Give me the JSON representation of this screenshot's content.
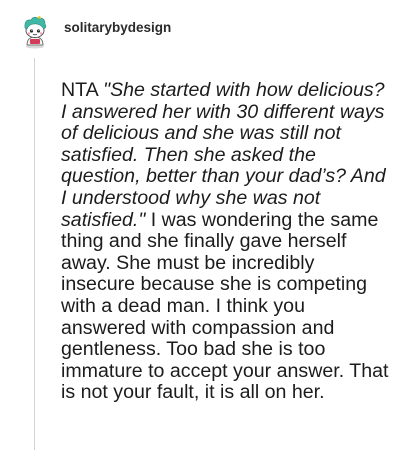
{
  "comment": {
    "username": "solitarybydesign",
    "avatar_icon": "snoo-avatar-icon",
    "body_prefix": "NTA ",
    "body_quote": "\"She started with how delicious? I answered her with 30 different ways of delicious and she was still not satisfied. Then she asked the question, better than your dad’s? And I understood why she was not satisfied.\"",
    "body_rest": " I was wondering the same thing and she finally gave herself away. She must be incredibly insecure because she is competing with a dead man. I think you answered with compassion and gentleness. Too bad she is too immature to accept your answer. That is not your fault, it is all on her."
  },
  "colors": {
    "text": "#1c1c1c",
    "username": "#2b2b2b",
    "thread_line": "#d4d4d4",
    "avatar_hair": "#3fb9a6"
  }
}
